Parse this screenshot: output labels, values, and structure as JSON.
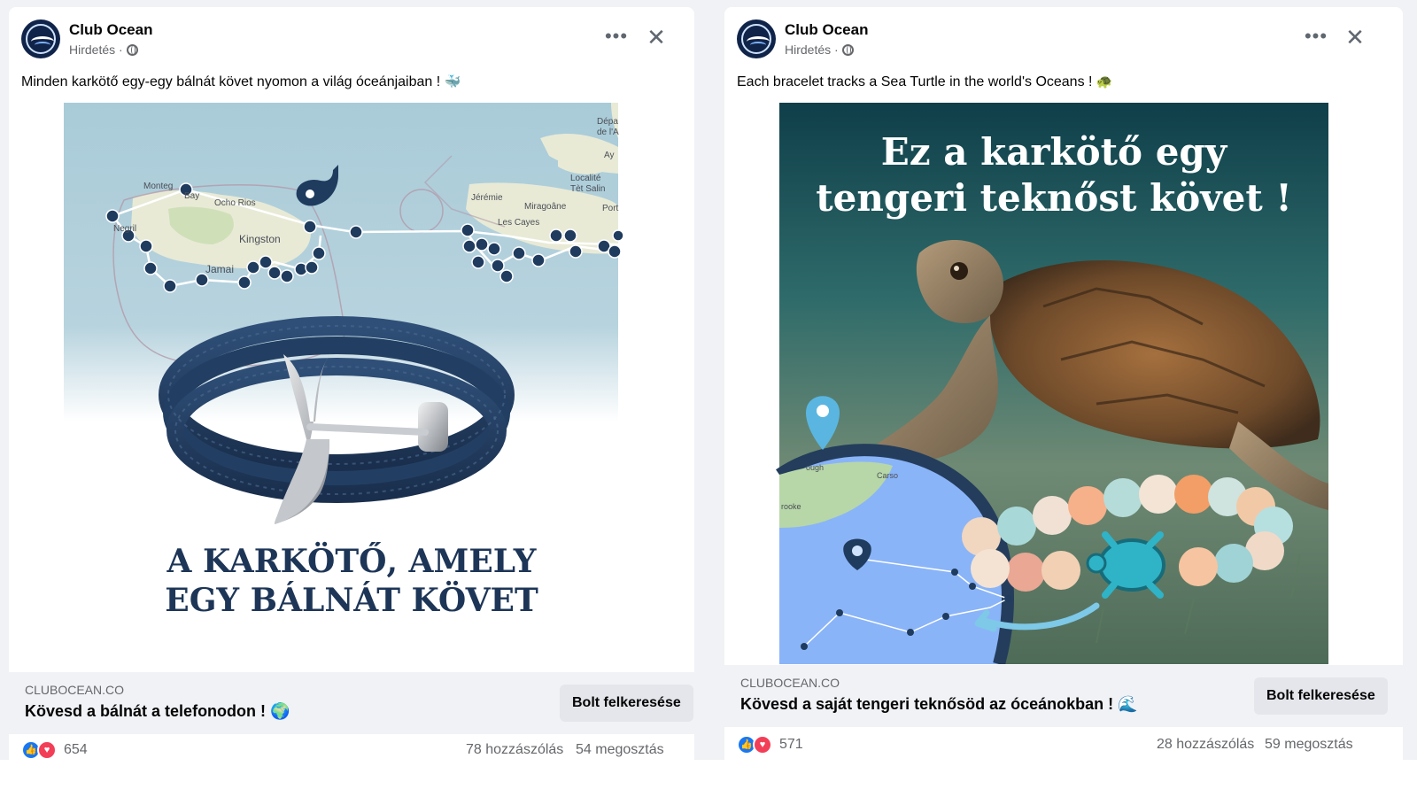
{
  "posts": [
    {
      "page_name": "Club Ocean",
      "sponsored_label": "Hirdetés ·",
      "text": "Minden karkötő egy-egy bálnát követ nyomon a világ óceánjaiban !",
      "text_emoji": "🐳",
      "image": {
        "map_labels": [
          "Monteg",
          "Bay",
          "Ocho Rios",
          "Negril",
          "Kingston",
          "Jamai",
          "Jérémie",
          "Miragoâne",
          "Les Cayes",
          "Port",
          "Localité",
          "Tèt Salin",
          "Dépa",
          "de l'A",
          "Ay"
        ],
        "headline_line1": "A KARKÖTŐ, AMELY",
        "headline_line2": "EGY BÁLNÁT KÖVET"
      },
      "link": {
        "domain": "CLUBOCEAN.CO",
        "title": "Kövesd a bálnát a telefonodon !",
        "title_emoji": "🌍",
        "cta": "Bolt felkeresése"
      },
      "stats": {
        "reactions": "654",
        "comments": "78 hozzászólás",
        "shares": "54 megosztás"
      }
    },
    {
      "page_name": "Club Ocean",
      "sponsored_label": "Hirdetés ·",
      "text": "Each bracelet tracks a Sea Turtle in the world's Oceans !",
      "text_emoji": "🐢",
      "image": {
        "headline_line1": "Ez a karkötő egy",
        "headline_line2": "tengeri teknőst követ !",
        "map_labels": [
          "ough",
          "Carso",
          "rooke"
        ]
      },
      "link": {
        "domain": "CLUBOCEAN.CO",
        "title": "Kövesd a saját tengeri teknősöd az óceánokban !",
        "title_emoji": "🌊",
        "cta": "Bolt felkeresése"
      },
      "stats": {
        "reactions": "571",
        "comments": "28 hozzászólás",
        "shares": "59 megosztás"
      }
    }
  ],
  "colors": {
    "navy": "#1d3557",
    "map_sea": "#a9cbd8",
    "cta_bg": "#e4e6eb",
    "like_blue": "#1877f2",
    "love_red": "#f33e58"
  },
  "icons": {
    "more": "more-horizontal-icon",
    "close": "close-icon",
    "globe": "globe-icon",
    "like": "like-icon",
    "love": "love-icon"
  }
}
